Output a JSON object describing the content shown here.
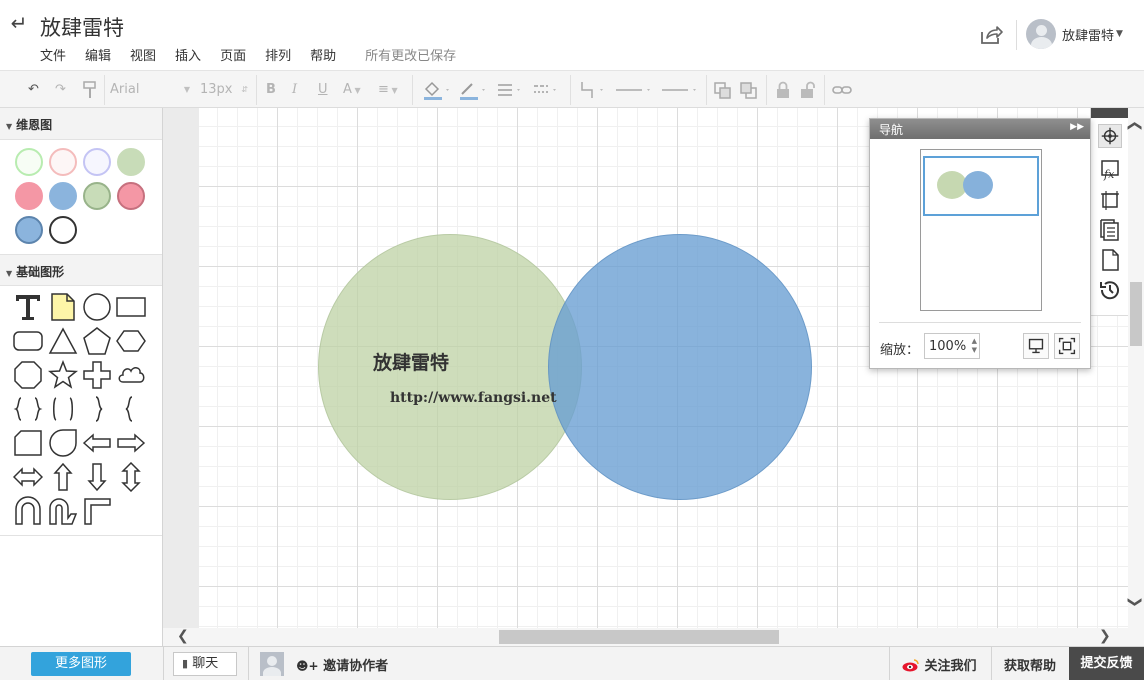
{
  "app": {
    "doc_title": "放肆雷特",
    "save_status": "所有更改已保存"
  },
  "menu": [
    "文件",
    "编辑",
    "视图",
    "插入",
    "页面",
    "排列",
    "帮助"
  ],
  "user": {
    "name": "放肆雷特"
  },
  "toolbar": {
    "font_family": "Arial",
    "font_size": "13px"
  },
  "sidebar": {
    "sections": [
      {
        "title": "维恩图",
        "swatches": [
          {
            "fill": "#f7fdf5",
            "stroke": "#b8ecb0"
          },
          {
            "fill": "#fdf6f6",
            "stroke": "#f4bcbc"
          },
          {
            "fill": "#f6f6fe",
            "stroke": "#c4c4f4"
          },
          {
            "fill": "#c8dcb8",
            "stroke": "#c8dcb8"
          },
          {
            "fill": "#f497a5",
            "stroke": "#f497a5"
          },
          {
            "fill": "#8bb4dd",
            "stroke": "#8bb4dd"
          },
          {
            "fill": "#c8dcb8",
            "stroke": "#98b38a"
          },
          {
            "fill": "#f497a5",
            "stroke": "#c6707e"
          },
          {
            "fill": "#8bb4dd",
            "stroke": "#5c84ad"
          },
          {
            "fill": "#ffffff",
            "stroke": "#333333"
          }
        ]
      },
      {
        "title": "基础图形",
        "shapes": [
          "text-icon",
          "note-icon",
          "circle-icon",
          "rectangle-icon",
          "rounded-rectangle-icon",
          "triangle-icon",
          "pentagon-icon",
          "hexagon-icon",
          "octagon-icon",
          "star-icon",
          "cross-icon",
          "cloud-icon",
          "brace-pair-icon",
          "bracket-pair-icon",
          "right-brace-icon",
          "left-brace-icon",
          "card-icon",
          "teardrop-icon",
          "left-arrow-icon",
          "right-arrow-icon",
          "left-right-arrow-icon",
          "up-arrow-icon",
          "down-arrow-icon",
          "up-down-arrow-icon",
          "u-turn-icon",
          "double-u-icon",
          "corner-icon"
        ]
      }
    ],
    "more_shapes": "更多图形"
  },
  "canvas": {
    "title": "放肆雷特",
    "url": "http://www.fangsi.net",
    "colors": {
      "green": "#bed2a4",
      "blue": "#689ed2"
    }
  },
  "navigator": {
    "title": "导航",
    "zoom_label": "缩放：",
    "zoom_value": "100%"
  },
  "bottom": {
    "chat": "聊天",
    "invite": "邀请协作者",
    "follow": "关注我们",
    "help": "获取帮助",
    "feedback": "提交反馈"
  }
}
